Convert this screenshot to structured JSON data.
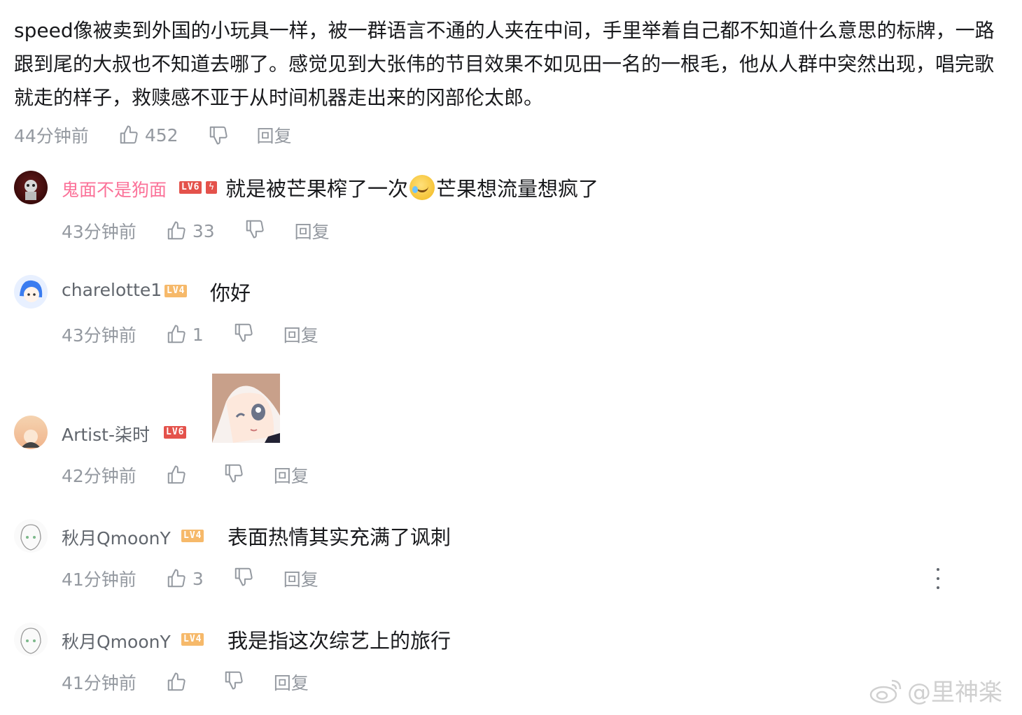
{
  "top_comment": {
    "text": "speed像被卖到外国的小玩具一样，被一群语言不通的人夹在中间，手里举着自己都不知道什么意思的标牌，一路跟到尾的大叔也不知道去哪了。感觉见到大张伟的节目效果不如见田一名的一根毛，他从人群中突然出现，唱完歌就走的样子，救赎感不亚于从时间机器走出来的冈部伦太郎。",
    "time": "44分钟前",
    "likes": "452",
    "reply_label": "回复"
  },
  "replies": [
    {
      "username": "鬼面不是狗面",
      "level": "LV6",
      "text_a": "就是被芒果榨了一次",
      "text_b": "芒果想流量想疯了",
      "time": "43分钟前",
      "likes": "33",
      "reply_label": "回复"
    },
    {
      "username": "charelotte1",
      "level": "LV4",
      "text": "你好",
      "time": "43分钟前",
      "likes": "1",
      "reply_label": "回复"
    },
    {
      "username": "Artist-柒时",
      "level": "LV6",
      "time": "42分钟前",
      "reply_label": "回复"
    },
    {
      "username": "秋月QmoonY",
      "level": "LV4",
      "text": "表面热情其实充满了讽刺",
      "time": "41分钟前",
      "likes": "3",
      "reply_label": "回复"
    },
    {
      "username": "秋月QmoonY",
      "level": "LV4",
      "text": "我是指这次综艺上的旅行",
      "time": "41分钟前",
      "reply_label": "回复"
    }
  ],
  "watermark": "@里神楽",
  "colors": {
    "text": "#18191c",
    "meta": "#9499a0",
    "vip_name": "#fb7299",
    "lv6": "#e4524b",
    "lv4": "#f6b96a"
  }
}
